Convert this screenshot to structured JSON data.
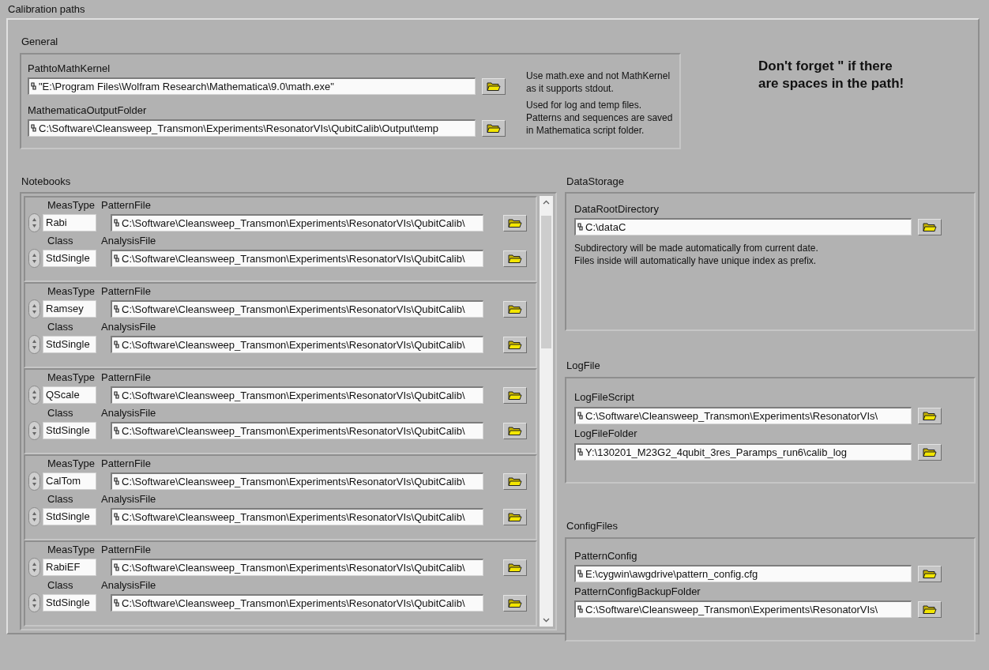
{
  "panel": {
    "title": "Calibration paths"
  },
  "general": {
    "title": "General",
    "fields": [
      {
        "label": "PathtoMathKernel",
        "value": "\"E:\\Program Files\\Wolfram Research\\Mathematica\\9.0\\math.exe\"",
        "note": [
          "Use math.exe and not MathKernel",
          "as it supports stdout."
        ]
      },
      {
        "label": "MathematicaOutputFolder",
        "value": "C:\\Software\\Cleansweep_Transmon\\Experiments\\ResonatorVIs\\QubitCalib\\Output\\temp",
        "note": [
          "Used for log and temp files.",
          "Patterns and sequences are saved",
          "in Mathematica script folder."
        ]
      }
    ],
    "warning": [
      "Don't forget \" if there",
      "are spaces in the path!"
    ]
  },
  "notebooks": {
    "title": "Notebooks",
    "items": [
      {
        "meas_type_label": "MeasType",
        "meas_type": "Rabi",
        "pattern_label": "PatternFile",
        "pattern_file": "C:\\Software\\Cleansweep_Transmon\\Experiments\\ResonatorVIs\\QubitCalib\\",
        "class_label": "Class",
        "class": "StdSingle",
        "analysis_label": "AnalysisFile",
        "analysis_file": "C:\\Software\\Cleansweep_Transmon\\Experiments\\ResonatorVIs\\QubitCalib\\"
      },
      {
        "meas_type_label": "MeasType",
        "meas_type": "Ramsey",
        "pattern_label": "PatternFile",
        "pattern_file": "C:\\Software\\Cleansweep_Transmon\\Experiments\\ResonatorVIs\\QubitCalib\\",
        "class_label": "Class",
        "class": "StdSingle",
        "analysis_label": "AnalysisFile",
        "analysis_file": "C:\\Software\\Cleansweep_Transmon\\Experiments\\ResonatorVIs\\QubitCalib\\"
      },
      {
        "meas_type_label": "MeasType",
        "meas_type": "QScale",
        "pattern_label": "PatternFile",
        "pattern_file": "C:\\Software\\Cleansweep_Transmon\\Experiments\\ResonatorVIs\\QubitCalib\\",
        "class_label": "Class",
        "class": "StdSingle",
        "analysis_label": "AnalysisFile",
        "analysis_file": "C:\\Software\\Cleansweep_Transmon\\Experiments\\ResonatorVIs\\QubitCalib\\"
      },
      {
        "meas_type_label": "MeasType",
        "meas_type": "CalTom",
        "pattern_label": "PatternFile",
        "pattern_file": "C:\\Software\\Cleansweep_Transmon\\Experiments\\ResonatorVIs\\QubitCalib\\",
        "class_label": "Class",
        "class": "StdSingle",
        "analysis_label": "AnalysisFile",
        "analysis_file": "C:\\Software\\Cleansweep_Transmon\\Experiments\\ResonatorVIs\\QubitCalib\\"
      },
      {
        "meas_type_label": "MeasType",
        "meas_type": "RabiEF",
        "pattern_label": "PatternFile",
        "pattern_file": "C:\\Software\\Cleansweep_Transmon\\Experiments\\ResonatorVIs\\QubitCalib\\",
        "class_label": "Class",
        "class": "StdSingle",
        "analysis_label": "AnalysisFile",
        "analysis_file": "C:\\Software\\Cleansweep_Transmon\\Experiments\\ResonatorVIs\\QubitCalib\\"
      }
    ]
  },
  "data_storage": {
    "title": "DataStorage",
    "fields": [
      {
        "label": "DataRootDirectory",
        "value": "C:\\dataC"
      }
    ],
    "note": [
      "Subdirectory will be made automatically from current date.",
      "Files inside will automatically have unique index as prefix."
    ]
  },
  "log_file": {
    "title": "LogFile",
    "fields": [
      {
        "label": "LogFileScript",
        "value": "C:\\Software\\Cleansweep_Transmon\\Experiments\\ResonatorVIs\\"
      },
      {
        "label": "LogFileFolder",
        "value": "Y:\\130201_M23G2_4qubit_3res_Paramps_run6\\calib_log"
      }
    ]
  },
  "config_files": {
    "title": "ConfigFiles",
    "fields": [
      {
        "label": "PatternConfig",
        "value": "E:\\cygwin\\awgdrive\\pattern_config.cfg"
      },
      {
        "label": "PatternConfigBackupFolder",
        "value": "C:\\Software\\Cleansweep_Transmon\\Experiments\\ResonatorVIs\\"
      }
    ]
  }
}
